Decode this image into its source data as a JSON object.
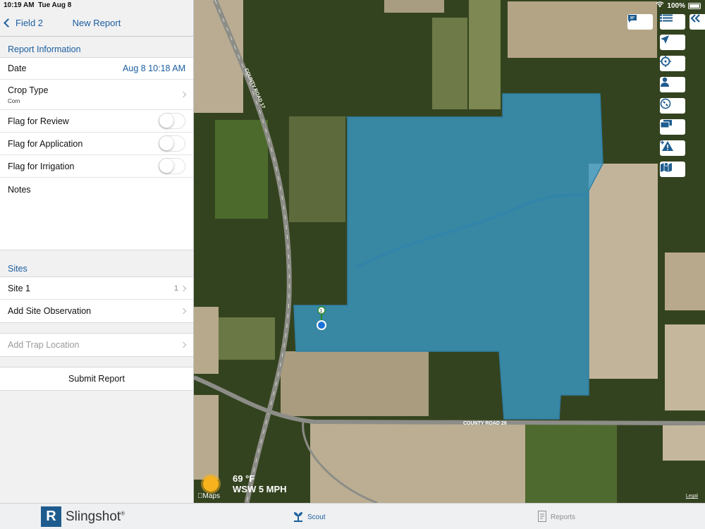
{
  "status": {
    "time": "10:19 AM",
    "date": "Tue Aug 8",
    "battery": "100%"
  },
  "nav": {
    "back_label": "Field 2",
    "title": "New Report"
  },
  "report_info": {
    "header": "Report Information",
    "date_label": "Date",
    "date_value": "Aug 8  10:18 AM",
    "crop_type_label": "Crop Type",
    "crop_type_value": "Corn",
    "flag_review": "Flag for Review",
    "flag_application": "Flag for Application",
    "flag_irrigation": "Flag for Irrigation",
    "notes_label": "Notes"
  },
  "sites": {
    "header": "Sites",
    "site1_label": "Site 1",
    "site1_count": "1",
    "add_observation": "Add Site Observation"
  },
  "trap": {
    "label": "Add Trap Location"
  },
  "submit_label": "Submit Report",
  "map": {
    "road_label_1": "COUNTY ROAD 17",
    "road_label_2": "COUNTY ROAD 26",
    "marker_label": "1",
    "weather_temp": "69 °F",
    "weather_wind": "WSW 5 MPH",
    "maps_label": "Maps",
    "legal_label": "Legal",
    "field_fill": "#3a9bc9",
    "toolbar_icons": [
      "chat-icon",
      "list-icon",
      "collapse-icon",
      "navigate-arrow-icon",
      "target-icon",
      "person-icon",
      "compass-icon",
      "layers-icon",
      "add-warning-icon",
      "map-book-icon"
    ]
  },
  "tabbar": {
    "brand_letter": "R",
    "brand_name": "Slingshot",
    "brand_reg": "®",
    "scout_label": "Scout",
    "reports_label": "Reports",
    "active_color": "#1b5e9e"
  }
}
